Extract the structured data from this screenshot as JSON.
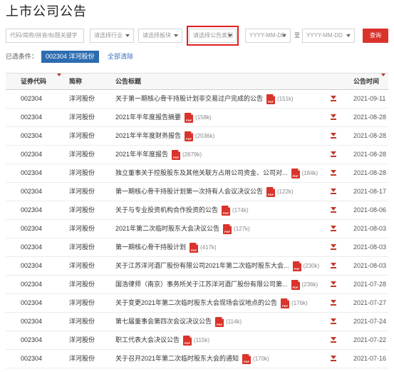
{
  "page": {
    "title": "上市公司公告"
  },
  "filters": {
    "keyword_placeholder": "代码/简称/拼音/标题关键字",
    "industry_label": "请选择行业",
    "sector_label": "请选择板块",
    "category_label": "请选择公告类别",
    "date_start_placeholder": "YYYY-MM-DD",
    "date_to_label": "至",
    "date_end_placeholder": "YYYY-MM-DD",
    "query_label": "查询",
    "highlight_color": "#e02020"
  },
  "conditions": {
    "label": "已选条件：",
    "tag": "002304 洋河股份",
    "clear_label": "全部清除"
  },
  "table": {
    "headers": {
      "code": "证券代码",
      "name": "简称",
      "title": "公告标题",
      "date": "公告时间"
    },
    "rows": [
      {
        "code": "002304",
        "name": "洋河股份",
        "title": "关于第一期核心骨干持股计划非交易过户完成的公告",
        "size": "(151k)",
        "date": "2021-09-11"
      },
      {
        "code": "002304",
        "name": "洋河股份",
        "title": "2021年半年度报告摘要",
        "size": "(158k)",
        "date": "2021-08-28"
      },
      {
        "code": "002304",
        "name": "洋河股份",
        "title": "2021年半年度财务报告",
        "size": "(2036k)",
        "date": "2021-08-28"
      },
      {
        "code": "002304",
        "name": "洋河股份",
        "title": "2021年半年度报告",
        "size": "(2679k)",
        "date": "2021-08-28"
      },
      {
        "code": "002304",
        "name": "洋河股份",
        "title": "独立董事关于控股股东及其他关联方占用公司资金、公司对...",
        "size": "(184k)",
        "date": "2021-08-28"
      },
      {
        "code": "002304",
        "name": "洋河股份",
        "title": "第一期核心骨干持股计划第一次持有人会议决议公告",
        "size": "(122k)",
        "date": "2021-08-17"
      },
      {
        "code": "002304",
        "name": "洋河股份",
        "title": "关于与专业投资机构合作投资的公告",
        "size": "(174k)",
        "date": "2021-08-06"
      },
      {
        "code": "002304",
        "name": "洋河股份",
        "title": "2021年第二次临时股东大会决议公告",
        "size": "(127k)",
        "date": "2021-08-03"
      },
      {
        "code": "002304",
        "name": "洋河股份",
        "title": "第一期核心骨干持股计划",
        "size": "(417k)",
        "date": "2021-08-03"
      },
      {
        "code": "002304",
        "name": "洋河股份",
        "title": "关于江苏洋河酒厂股份有限公司2021年第二次临时股东大会...",
        "size": "(230k)",
        "date": "2021-08-03"
      },
      {
        "code": "002304",
        "name": "洋河股份",
        "title": "国浩律师（南京）事务所关于江苏洋河酒厂股份有限公司第...",
        "size": "(236k)",
        "date": "2021-07-28"
      },
      {
        "code": "002304",
        "name": "洋河股份",
        "title": "关于变更2021年第二次临时股东大会现场会议地点的公告",
        "size": "(176k)",
        "date": "2021-07-27"
      },
      {
        "code": "002304",
        "name": "洋河股份",
        "title": "第七届董事会第四次会议决议公告",
        "size": "(114k)",
        "date": "2021-07-24"
      },
      {
        "code": "002304",
        "name": "洋河股份",
        "title": "职工代表大会决议公告",
        "size": "(115k)",
        "date": "2021-07-22"
      },
      {
        "code": "002304",
        "name": "洋河股份",
        "title": "关于召开2021年第二次临时股东大会的通知",
        "size": "(170k)",
        "date": "2021-07-16"
      }
    ]
  },
  "colors": {
    "accent": "#d9332b",
    "tag_bg": "#2d6cb0",
    "link": "#3b6fb6"
  }
}
